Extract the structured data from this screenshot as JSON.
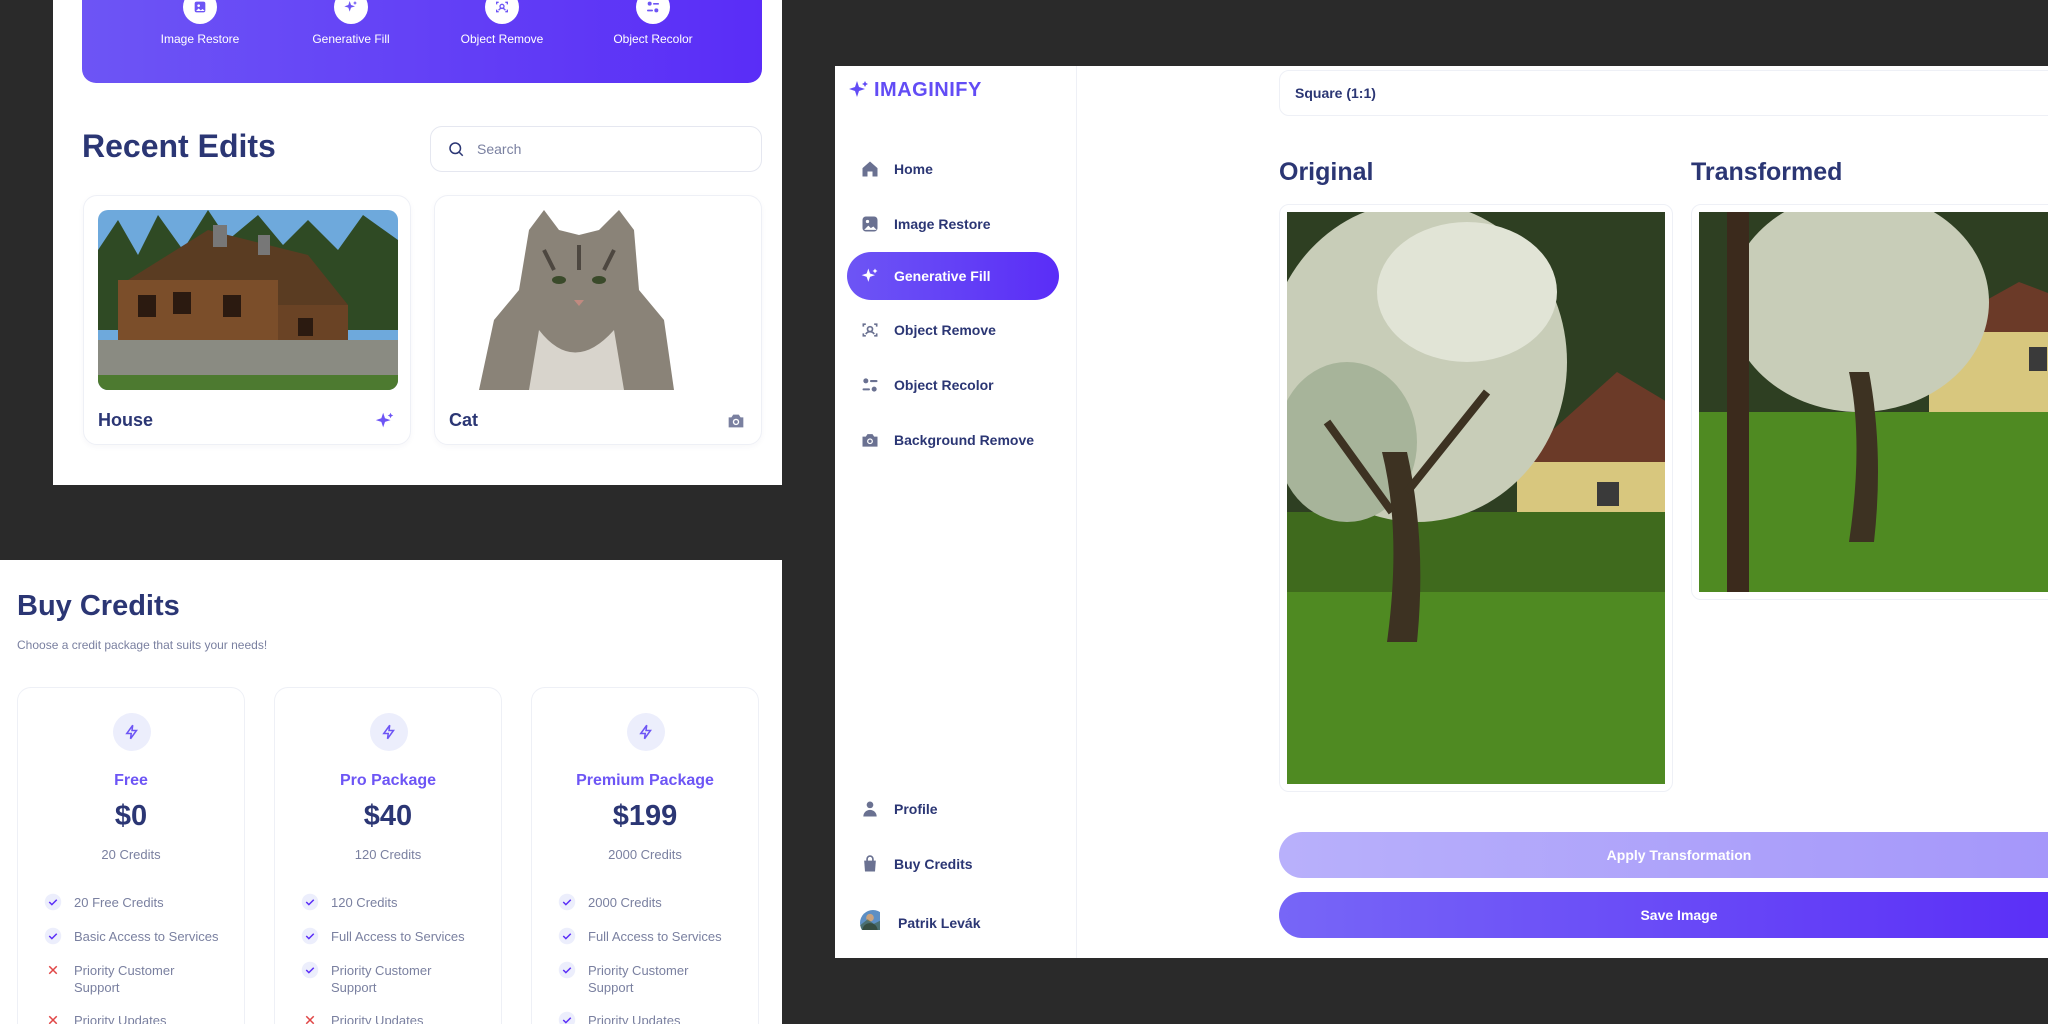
{
  "home": {
    "tools": [
      {
        "label": "Image Restore",
        "icon": "image-icon"
      },
      {
        "label": "Generative Fill",
        "icon": "sparkles-icon"
      },
      {
        "label": "Object Remove",
        "icon": "scan-icon"
      },
      {
        "label": "Object Recolor",
        "icon": "filter-icon"
      }
    ],
    "recent_title": "Recent Edits",
    "search_placeholder": "Search",
    "cards": [
      {
        "title": "House",
        "icon": "sparkles-icon"
      },
      {
        "title": "Cat",
        "icon": "camera-icon"
      }
    ]
  },
  "credits": {
    "title": "Buy Credits",
    "subtitle": "Choose a credit package that suits your needs!",
    "packages": [
      {
        "name": "Free",
        "price": "$0",
        "credits": "20 Credits",
        "features": [
          {
            "text": "20 Free Credits",
            "included": true
          },
          {
            "text": "Basic Access to Services",
            "included": true
          },
          {
            "text": "Priority Customer Support",
            "included": false
          },
          {
            "text": "Priority Updates",
            "included": false
          }
        ]
      },
      {
        "name": "Pro Package",
        "price": "$40",
        "credits": "120 Credits",
        "features": [
          {
            "text": "120 Credits",
            "included": true
          },
          {
            "text": "Full Access to Services",
            "included": true
          },
          {
            "text": "Priority Customer Support",
            "included": true
          },
          {
            "text": "Priority Updates",
            "included": false
          }
        ]
      },
      {
        "name": "Premium Package",
        "price": "$199",
        "credits": "2000 Credits",
        "features": [
          {
            "text": "2000 Credits",
            "included": true
          },
          {
            "text": "Full Access to Services",
            "included": true
          },
          {
            "text": "Priority Customer Support",
            "included": true
          },
          {
            "text": "Priority Updates",
            "included": true
          }
        ]
      }
    ]
  },
  "editor": {
    "brand": "IMAGINIFY",
    "nav": [
      {
        "label": "Home",
        "icon": "home-icon",
        "active": false
      },
      {
        "label": "Image Restore",
        "icon": "image-icon",
        "active": false
      },
      {
        "label": "Generative Fill",
        "icon": "sparkles-icon",
        "active": true
      },
      {
        "label": "Object Remove",
        "icon": "scan-icon",
        "active": false
      },
      {
        "label": "Object Recolor",
        "icon": "filter-icon",
        "active": false
      },
      {
        "label": "Background Remove",
        "icon": "camera-icon",
        "active": false
      }
    ],
    "bottom_nav": [
      {
        "label": "Profile",
        "icon": "user-icon"
      },
      {
        "label": "Buy Credits",
        "icon": "bag-icon"
      }
    ],
    "user_name": "Patrik Levák",
    "aspect_ratio": "Square (1:1)",
    "original_label": "Original",
    "transformed_label": "Transformed",
    "apply_label": "Apply Transformation",
    "save_label": "Save Image"
  },
  "colors": {
    "accent": "#5a2df7",
    "accent_light": "#6d55f5",
    "navy": "#2b3674",
    "muted": "#7a80a0",
    "background": "#2a2a2a"
  }
}
